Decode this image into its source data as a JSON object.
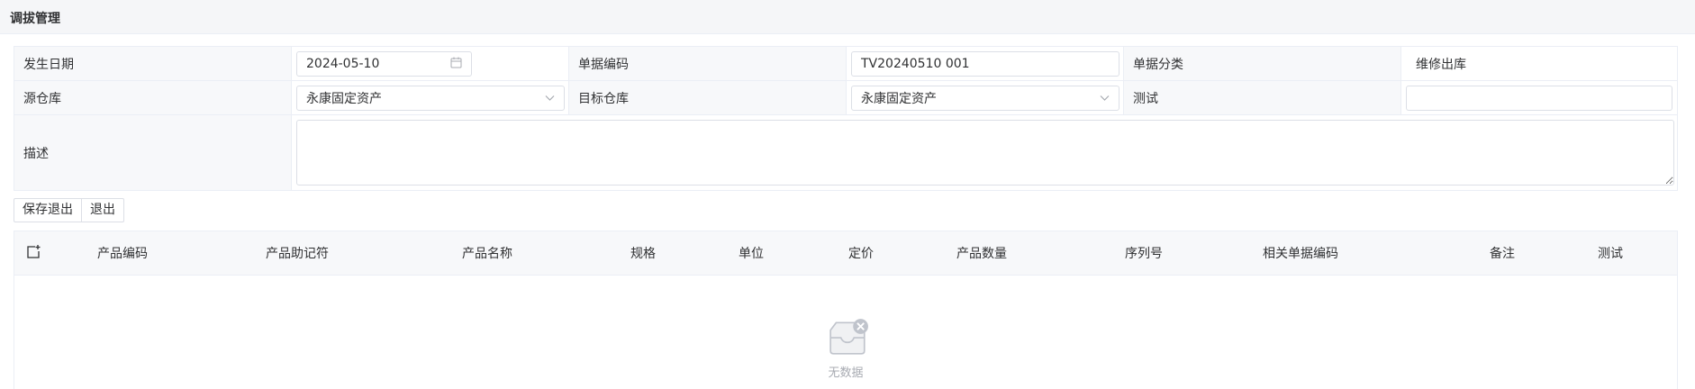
{
  "page": {
    "title": "调拔管理"
  },
  "form": {
    "date_label": "发生日期",
    "date_value": "2024-05-10",
    "code_label": "单据编码",
    "code_value": "TV20240510 001",
    "category_label": "单据分类",
    "category_value": "维修出库",
    "source_label": "源仓库",
    "source_value": "永康固定资产",
    "target_label": "目标仓库",
    "target_value": "永康固定资产",
    "test_label": "测试",
    "test_value": "",
    "desc_label": "描述",
    "desc_value": ""
  },
  "buttons": {
    "save_exit": "保存退出",
    "exit": "退出"
  },
  "table": {
    "columns": [
      "产品编码",
      "产品助记符",
      "产品名称",
      "规格",
      "单位",
      "定价",
      "产品数量",
      "序列号",
      "相关单据编码",
      "备注",
      "测试"
    ],
    "empty_text": "无数据"
  },
  "colors": {
    "border": "#ebeef5",
    "label_bg": "#f7f8fa",
    "muted": "#a8abb2"
  }
}
